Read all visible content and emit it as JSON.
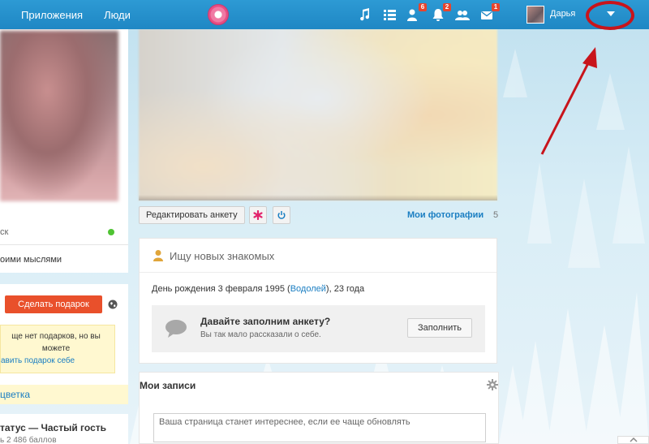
{
  "topbar": {
    "nav": [
      "",
      "Приложения",
      "Люди"
    ],
    "icons": [
      {
        "name": "music-icon",
        "badge": ""
      },
      {
        "name": "feed-icon",
        "badge": ""
      },
      {
        "name": "friends-icon",
        "badge": "6"
      },
      {
        "name": "bell-icon",
        "badge": "2"
      },
      {
        "name": "guests-icon",
        "badge": ""
      },
      {
        "name": "mail-icon",
        "badge": "1"
      }
    ],
    "user_name": "Дарья",
    "colors": {
      "bar": "#1f87c4",
      "annotation": "#c8141b"
    }
  },
  "left": {
    "status_fragment": "ск",
    "thoughts_fragment": "оими мыслями",
    "gift_button": "Сделать подарок",
    "gift_note_line1": "ще нет подарков, но вы",
    "gift_note_line2": "можете",
    "gift_note_link": "авить подарок себе",
    "flower_link": "цветка",
    "status_title": "татус — Частый гость",
    "status_points": "ь 2 486 баллов"
  },
  "profile": {
    "edit_button": "Редактировать анкету",
    "photos_link": "Мои фотографии",
    "photos_count": "5",
    "about_title": "Ищу новых знакомых",
    "birthday_prefix": "День рождения 3 февраля 1995 (",
    "birthday_sign": "Водолей",
    "birthday_suffix": "), 23 года",
    "fill_title": "Давайте заполним анкету?",
    "fill_sub": "Вы так мало рассказали о себе.",
    "fill_button": "Заполнить",
    "notes_title": "Мои записи",
    "notes_placeholder": "Ваша страница станет интереснее, если ее чаще обновлять"
  }
}
